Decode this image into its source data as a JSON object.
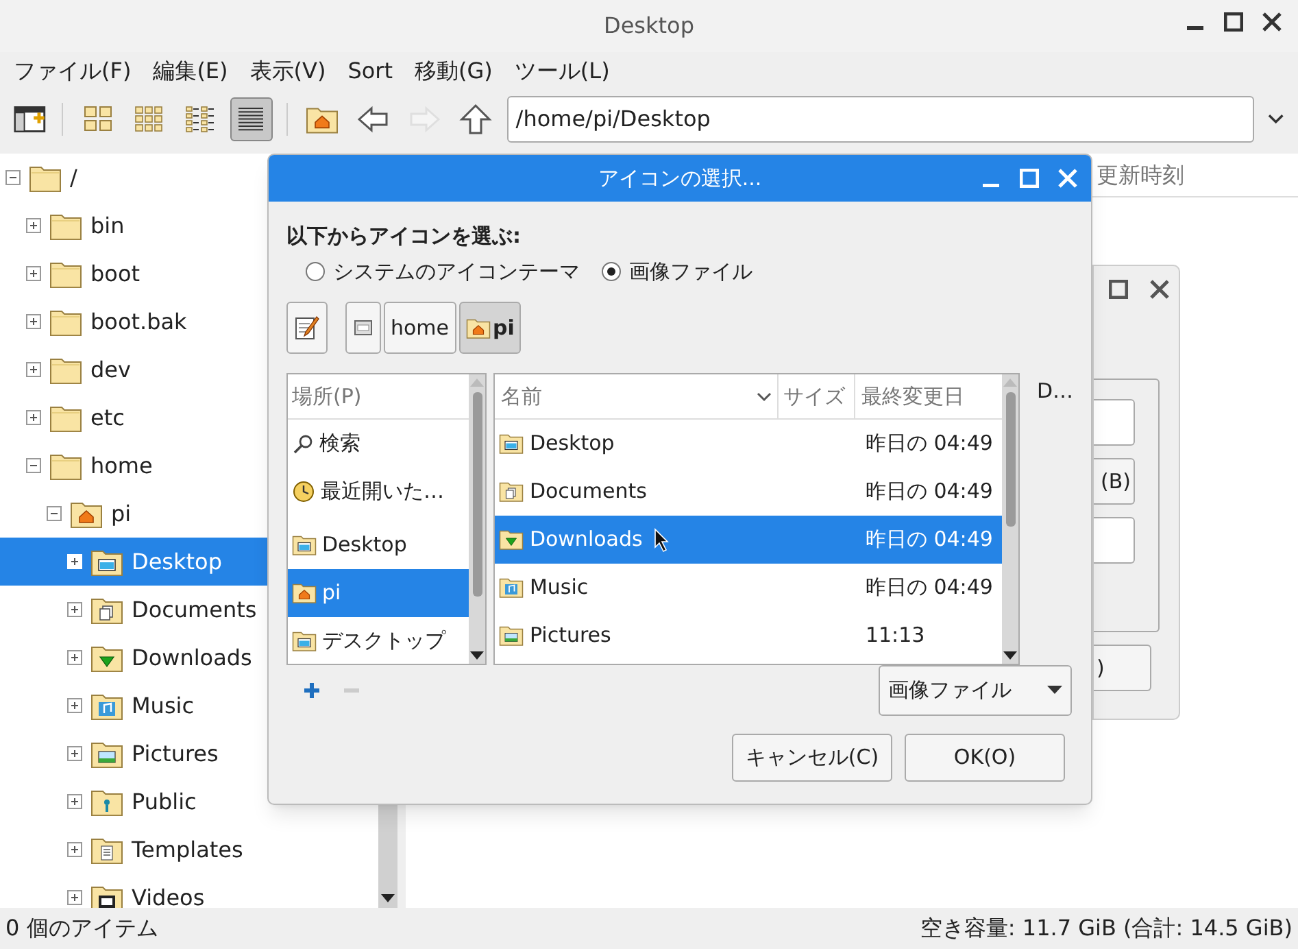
{
  "window": {
    "title": "Desktop"
  },
  "menu": [
    "ファイル(F)",
    "編集(E)",
    "表示(V)",
    "Sort",
    "移動(G)",
    "ツール(L)"
  ],
  "toolbar": {
    "views": [
      {
        "kind": "icons",
        "selected": false
      },
      {
        "kind": "thumbnails",
        "selected": false
      },
      {
        "kind": "compact",
        "selected": false
      },
      {
        "kind": "list",
        "selected": true
      }
    ],
    "nav": [
      {
        "kind": "home",
        "disabled": false
      },
      {
        "kind": "back",
        "disabled": false
      },
      {
        "kind": "forward",
        "disabled": true
      },
      {
        "kind": "up",
        "disabled": false
      }
    ],
    "path": "/home/pi/Desktop"
  },
  "tree": [
    {
      "label": "/",
      "kind": "folder",
      "expanded": true,
      "selected": false,
      "children": [
        {
          "label": "bin",
          "kind": "folder",
          "expanded": false,
          "selected": false
        },
        {
          "label": "boot",
          "kind": "folder",
          "expanded": false,
          "selected": false
        },
        {
          "label": "boot.bak",
          "kind": "folder",
          "expanded": false,
          "selected": false
        },
        {
          "label": "dev",
          "kind": "folder",
          "expanded": false,
          "selected": false
        },
        {
          "label": "etc",
          "kind": "folder",
          "expanded": false,
          "selected": false
        },
        {
          "label": "home",
          "kind": "folder",
          "expanded": true,
          "selected": false,
          "children": [
            {
              "label": "pi",
              "kind": "home",
              "expanded": true,
              "selected": false,
              "children": [
                {
                  "label": "Desktop",
                  "kind": "desktop",
                  "expanded": false,
                  "selected": true
                },
                {
                  "label": "Documents",
                  "kind": "documents",
                  "expanded": false,
                  "selected": false
                },
                {
                  "label": "Downloads",
                  "kind": "downloads",
                  "expanded": false,
                  "selected": false
                },
                {
                  "label": "Music",
                  "kind": "music",
                  "expanded": false,
                  "selected": false
                },
                {
                  "label": "Pictures",
                  "kind": "pictures",
                  "expanded": false,
                  "selected": false
                },
                {
                  "label": "Public",
                  "kind": "public",
                  "expanded": false,
                  "selected": false
                },
                {
                  "label": "Templates",
                  "kind": "templates",
                  "expanded": false,
                  "selected": false
                },
                {
                  "label": "Videos",
                  "kind": "videos",
                  "expanded": false,
                  "selected": false
                }
              ]
            }
          ]
        }
      ]
    }
  ],
  "file_view": {
    "column_heading": "更新時刻"
  },
  "status_bar": {
    "items": "0 個のアイテム",
    "free_space": "空き容量: 11.7 GiB (合計: 14.5 GiB)"
  },
  "back_dialog": {
    "buttons": [
      "(B)",
      ")"
    ]
  },
  "dialog": {
    "title": "アイコンの選択...",
    "prompt": "以下からアイコンを選ぶ:",
    "sources": [
      {
        "label": "システムのアイコンテーマ",
        "selected": false
      },
      {
        "label": "画像ファイル",
        "selected": true
      }
    ],
    "path_buttons": [
      {
        "kind": "drive",
        "selected": false
      },
      {
        "kind": "folder",
        "label": "home",
        "selected": false
      },
      {
        "kind": "home",
        "label": "pi",
        "selected": true
      }
    ],
    "places": {
      "header": "場所(P)",
      "items": [
        {
          "kind": "search",
          "label": "検索",
          "selected": false
        },
        {
          "kind": "recent",
          "label": "最近開いた…",
          "selected": false
        },
        {
          "kind": "desktop",
          "label": "Desktop",
          "selected": false
        },
        {
          "kind": "home",
          "label": "pi",
          "selected": true
        },
        {
          "kind": "desktop",
          "label": "デスクトップ",
          "selected": false
        }
      ]
    },
    "files": {
      "columns": [
        "名前",
        "サイズ",
        "最終変更日"
      ],
      "rows": [
        {
          "kind": "desktop",
          "name": "Desktop",
          "modified": "昨日の 04:49",
          "selected": false
        },
        {
          "kind": "documents",
          "name": "Documents",
          "modified": "昨日の 04:49",
          "selected": false
        },
        {
          "kind": "downloads",
          "name": "Downloads",
          "modified": "昨日の 04:49",
          "selected": true
        },
        {
          "kind": "music",
          "name": "Music",
          "modified": "昨日の 04:49",
          "selected": false
        },
        {
          "kind": "pictures",
          "name": "Pictures",
          "modified": "11:13",
          "selected": false
        }
      ]
    },
    "preview_label": "D…",
    "filter": "画像ファイル",
    "buttons": [
      "キャンセル(C)",
      "OK(O)"
    ]
  }
}
